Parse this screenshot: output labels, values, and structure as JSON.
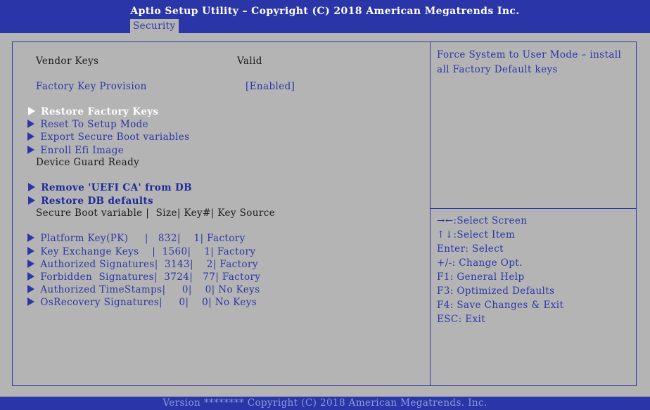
{
  "header": {
    "title": "Aptio Setup Utility – Copyright (C) 2018 American Megatrends Inc.",
    "tab": "Security"
  },
  "main": {
    "vendor_keys_label": "Vendor Keys",
    "vendor_keys_value": "Valid",
    "factory_key_provision_label": "Factory Key Provision",
    "factory_key_provision_value": "[Enabled]",
    "menu_items": [
      "Restore Factory Keys",
      "Reset To Setup Mode",
      "Export Secure Boot variables",
      "Enroll Efi Image"
    ],
    "device_guard_label": "Device Guard Ready",
    "device_guard_items": [
      "Remove 'UEFI CA' from DB",
      "Restore DB defaults"
    ],
    "sb_table": {
      "header": "Secure Boot variable |  Size| Key#| Key Source",
      "rows": [
        "Platform Key(PK)     |   832|    1| Factory",
        "Key Exchange Keys    |  1560|    1| Factory",
        "Authorized Signatures|  3143|    2| Factory",
        "Forbidden  Signatures|  3724|   77| Factory",
        "Authorized TimeStamps|     0|    0| No Keys",
        "OsRecovery Signatures|     0|    0| No Keys"
      ]
    }
  },
  "help_text": "Force System to User Mode – install all Factory Default keys",
  "key_legend": [
    "→←:Select Screen",
    "↑↓:Select Item",
    "Enter: Select",
    "+/-: Change Opt.",
    "F1: General Help",
    "F3: Optimized Defaults",
    "F4: Save Changes & Exit",
    "ESC: Exit"
  ],
  "footer": "Version ******** Copyright (C) 2018 American Megatrends. Inc.",
  "colors": {
    "accent": "#2a36a8",
    "background": "#b4b4b4",
    "selected": "#ffffff"
  }
}
